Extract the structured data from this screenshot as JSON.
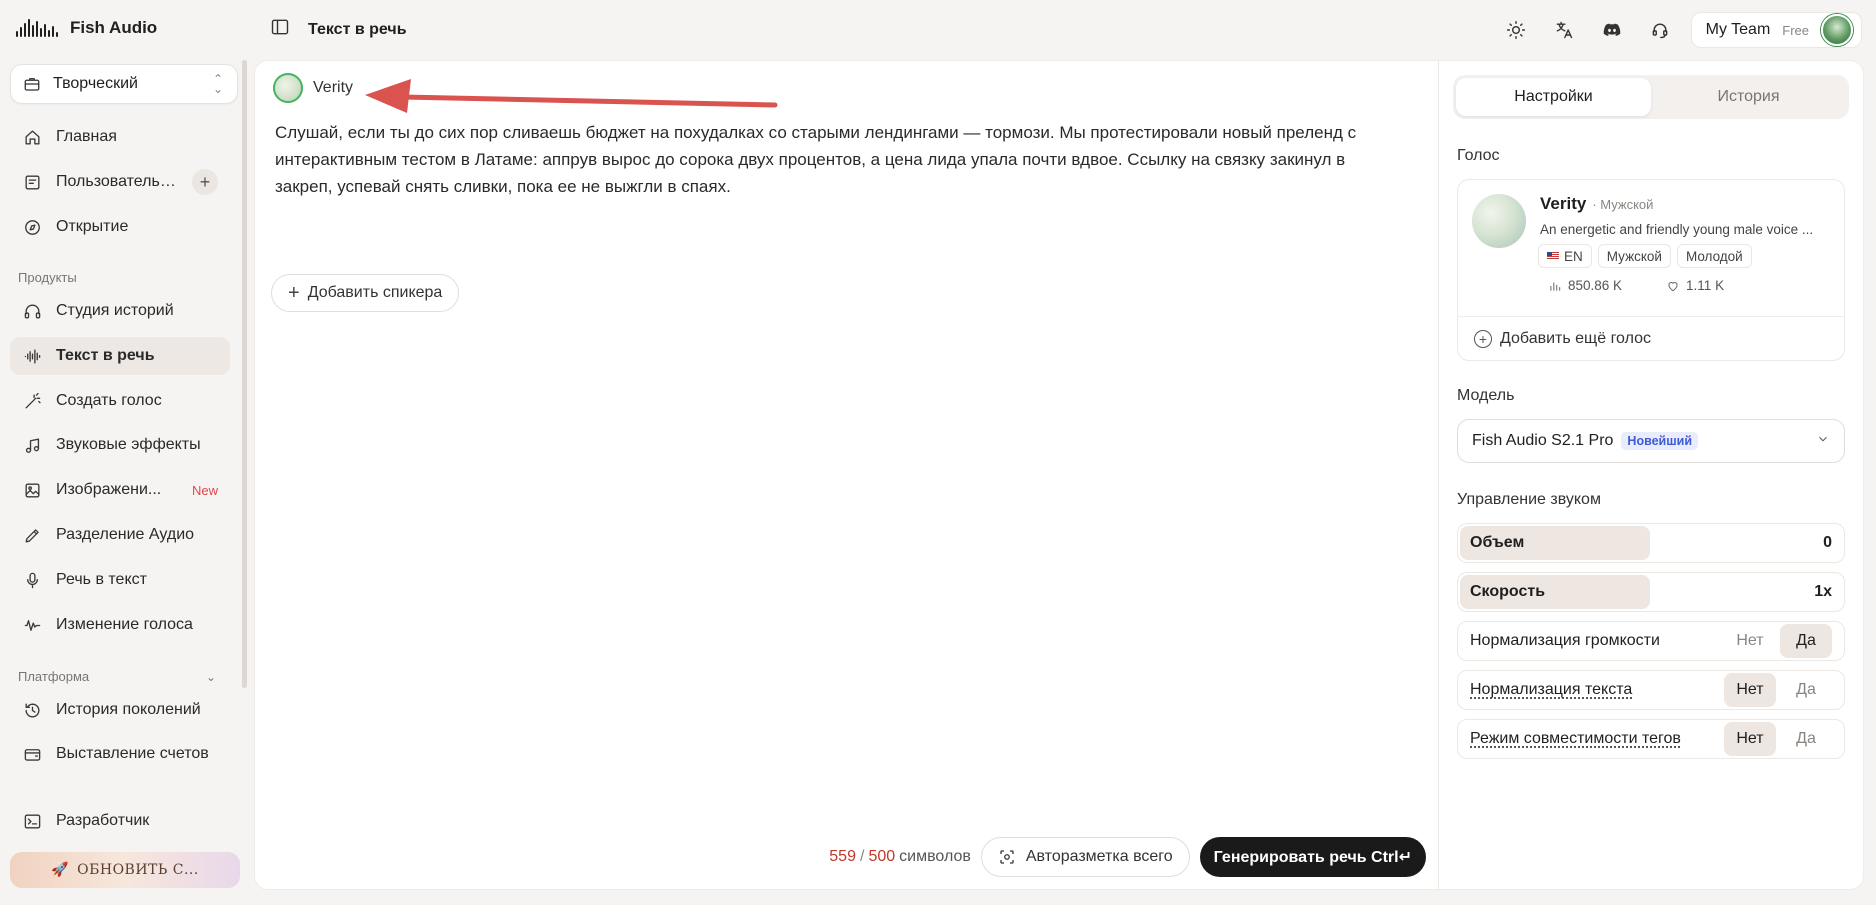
{
  "app": {
    "name": "Fish Audio"
  },
  "workspace": {
    "label": "Творческий"
  },
  "sidebar": {
    "items": [
      {
        "label": "Главная"
      },
      {
        "label": "Пользовательс..."
      },
      {
        "label": "Открытие"
      }
    ],
    "products_title": "Продукты",
    "products": [
      {
        "label": "Студия историй"
      },
      {
        "label": "Текст в речь"
      },
      {
        "label": "Создать голос"
      },
      {
        "label": "Звуковые эффекты"
      },
      {
        "label": "Изображени...",
        "badge": "New"
      },
      {
        "label": "Разделение Аудио"
      },
      {
        "label": "Речь в текст"
      },
      {
        "label": "Изменение голоса"
      }
    ],
    "platform_title": "Платформа",
    "platform": [
      {
        "label": "История поколений"
      },
      {
        "label": "Выставление счетов"
      },
      {
        "label": "Разработчик"
      }
    ],
    "upgrade_label": "ОБНОВИТЬ С..."
  },
  "topbar": {
    "page_title": "Текст в речь",
    "team_name": "My Team",
    "plan": "Free"
  },
  "editor": {
    "speaker_name": "Verity",
    "text": "Слушай, если ты до сих пор сливаешь бюджет на похудалках со старыми лендингами — тормози. Мы протестировали новый преленд с интерактивным тестом в Латаме: аппрув вырос до сорока двух процентов, а цена лида упала почти вдвое. Ссылку на связку закинул в закреп, успевай снять сливки, пока ее не выжгли в спаях.",
    "add_speaker_label": "Добавить спикера",
    "chars_used": "559",
    "chars_sep": "/",
    "chars_limit": "500",
    "chars_unit": "символов",
    "auto_markup_label": "Авторазметка всего",
    "generate_label": "Генерировать речь Ctrl↵"
  },
  "settings": {
    "tabs": [
      {
        "label": "Настройки",
        "active": true
      },
      {
        "label": "История",
        "active": false
      }
    ],
    "voice_label": "Голос",
    "voice": {
      "name": "Verity",
      "gender": "· Мужской",
      "description": "An energetic and friendly young male voice ...",
      "tags": [
        "EN",
        "Мужской",
        "Молодой"
      ],
      "plays": "850.86 K",
      "likes": "1.11 K",
      "add_label": "Добавить ещё голос"
    },
    "model_label": "Модель",
    "model": {
      "name": "Fish Audio S2.1 Pro",
      "badge": "Новейший"
    },
    "sound_label": "Управление звуком",
    "volume": {
      "label": "Объем",
      "value": "0"
    },
    "speed": {
      "label": "Скорость",
      "value": "1x"
    },
    "loudness_norm": {
      "label": "Нормализация громкости",
      "no": "Нет",
      "yes": "Да",
      "selected": "yes"
    },
    "text_norm": {
      "label": "Нормализация текста",
      "no": "Нет",
      "yes": "Да",
      "selected": "no"
    },
    "tag_compat": {
      "label": "Режим совместимости тегов",
      "no": "Нет",
      "yes": "Да",
      "selected": "no"
    }
  },
  "colors": {
    "accent_dark": "#1a1a1a",
    "annotation_arrow": "#d9534f",
    "char_count_over": "#c0392b",
    "new_badge": "#e0474c",
    "model_badge": "#3f5bd6"
  }
}
